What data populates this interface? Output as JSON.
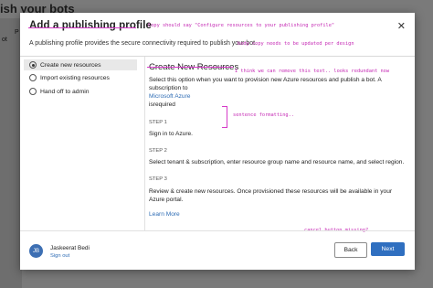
{
  "background": {
    "page_title": "ish your bots",
    "sidebar_items": [
      "ot",
      "P"
    ]
  },
  "modal": {
    "title": "Add a publishing profile",
    "subtitle": "A publishing profile provides the secure connectivity required to publish your bot.",
    "close_icon": "close-icon"
  },
  "options": [
    {
      "label": "Create new resources",
      "selected": true
    },
    {
      "label": "Import existing resources",
      "selected": false
    },
    {
      "label": "Hand off to admin",
      "selected": false
    }
  ],
  "content": {
    "title": "Create New Resources",
    "intro_1": "Select this option when you want to provision new Azure resources and publish a bot. A",
    "intro_2": "subscription to",
    "intro_link": "Microsoft Azure",
    "intro_3": "isrequired",
    "step1_label": "STEP 1",
    "step1_text": "Sign in to Azure.",
    "step2_label": "STEP 2",
    "step2_text": "Select tenant & subscription, enter resource group name and resource name, and select region.",
    "step3_label": "STEP 3",
    "step3_text": "Review & create new resources. Once provisioned these resources will be available in your Azure portal.",
    "learn_more": "Learn More"
  },
  "annotations": {
    "title_note": "Copy should say \"Configure resources to your publishing profile\"",
    "body_note": "body copy needs to be updated per design",
    "redundant_note": "I think we can remove this text.. looks redundant now",
    "sentence_note": "sentence formatting..",
    "cancel_note": "cancel button missing?"
  },
  "footer": {
    "avatar_initials": "JB",
    "user_name": "Jaskeerat Bedi",
    "sign_out": "Sign out",
    "back_label": "Back",
    "next_label": "Next"
  },
  "colors": {
    "annotation": "#c427b3",
    "primary": "#2f6fc0",
    "link": "#2f6db5"
  }
}
